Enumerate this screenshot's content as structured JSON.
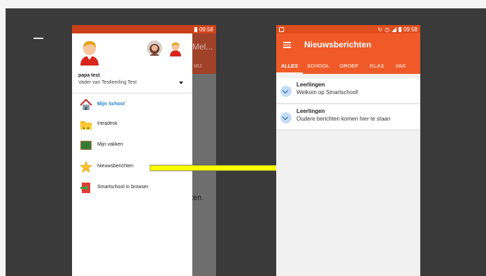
{
  "status_bar": {
    "time": "09:58"
  },
  "screen1": {
    "background_title": "Mel...",
    "background_tab": "MIJ",
    "background_text": "ten.",
    "drawer": {
      "user_name": "papa test",
      "user_role": "Vader van Testleerling Test",
      "menu": [
        {
          "label": "Mijn School",
          "icon": "house-icon",
          "active": true
        },
        {
          "label": "Intradesk",
          "icon": "folder-icon",
          "active": false
        },
        {
          "label": "Mijn vakken",
          "icon": "board-icon",
          "active": false
        },
        {
          "label": "Nieuwsberichten",
          "icon": "star-icon",
          "active": false
        },
        {
          "label": "Smartschool in browser",
          "icon": "browser-exit-icon",
          "active": false
        }
      ]
    }
  },
  "screen2": {
    "title": "Nieuwsberichten",
    "tabs": [
      "ALLES",
      "SCHOOL",
      "GROEP",
      "KLAS",
      "VAK"
    ],
    "active_tab": "ALLES",
    "news": [
      {
        "title": "Leerlingen",
        "body": "Welkom op Smartschool!"
      },
      {
        "title": "Leerlingen",
        "body": "Oudere berichten komen hier te staan"
      }
    ]
  },
  "colors": {
    "accent": "#f05a28",
    "status_bar": "#e04e1e",
    "arrow_fill": "#ffff00",
    "active_menu": "#1f7fd0"
  }
}
